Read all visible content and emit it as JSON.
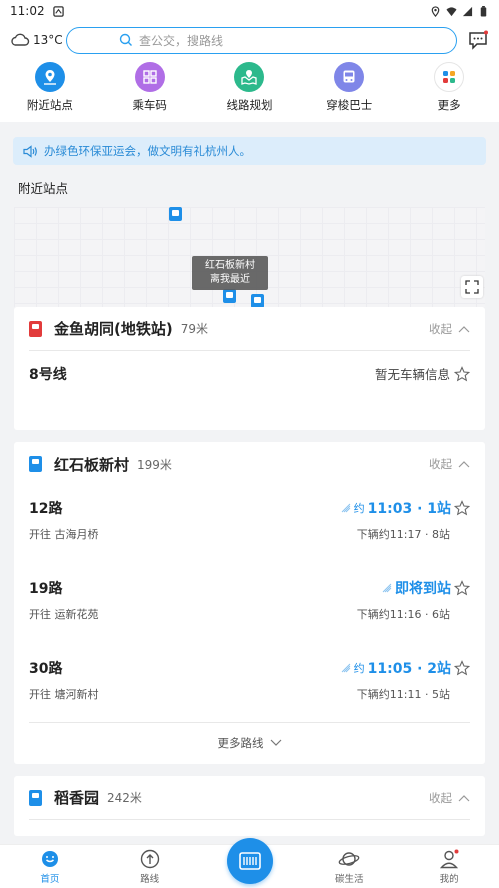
{
  "status": {
    "time": "11:02"
  },
  "header": {
    "temperature": "13°C",
    "search_placeholder": "查公交，搜路线"
  },
  "quick_actions": [
    {
      "label": "附近站点",
      "icon": "location-person-icon",
      "color": "#1e8fe8"
    },
    {
      "label": "乘车码",
      "icon": "qr-grid-icon",
      "color": "#b06ee6"
    },
    {
      "label": "线路规划",
      "icon": "route-map-icon",
      "color": "#2cb98c"
    },
    {
      "label": "穿梭巴士",
      "icon": "bus-icon",
      "color": "#7f86e8"
    },
    {
      "label": "更多",
      "icon": "more-grid-icon",
      "color": "#ffffff"
    }
  ],
  "notice": {
    "text": "办绿色环保亚运会，做文明有礼杭州人。"
  },
  "nearby": {
    "title": "附近站点",
    "tooltip_line1": "红石板新村",
    "tooltip_line2": "离我最近"
  },
  "stations": [
    {
      "name": "金鱼胡同(地铁站)",
      "distance": "79米",
      "collapse": "收起",
      "icon_color": "#e23b3b",
      "lines": [
        {
          "number": "8号线",
          "status": "暂无车辆信息"
        }
      ]
    },
    {
      "name": "红石板新村",
      "distance": "199米",
      "collapse": "收起",
      "icon_color": "#1e8fe8",
      "lines": [
        {
          "number": "12路",
          "direction": "开往 古海月桥",
          "eta_prefix": "约",
          "eta": "11:03 · 1站",
          "next": "下辆约11:17 · 8站"
        },
        {
          "number": "19路",
          "direction": "开往 运新花苑",
          "eta_prefix": "",
          "eta": "即将到站",
          "next": "下辆约11:16 · 6站"
        },
        {
          "number": "30路",
          "direction": "开往 塘河新村",
          "eta_prefix": "约",
          "eta": "11:05 · 2站",
          "next": "下辆约11:11 · 5站"
        }
      ],
      "more": "更多路线"
    },
    {
      "name": "稻香园",
      "distance": "242米",
      "collapse": "收起",
      "icon_color": "#1e8fe8"
    }
  ],
  "tabs": [
    {
      "label": "首页",
      "icon": "home-smile-icon",
      "active": true
    },
    {
      "label": "路线",
      "icon": "route-arrow-icon",
      "active": false
    },
    {
      "label": "碳生活",
      "icon": "planet-icon",
      "active": false
    },
    {
      "label": "我的",
      "icon": "user-icon",
      "active": false
    }
  ]
}
